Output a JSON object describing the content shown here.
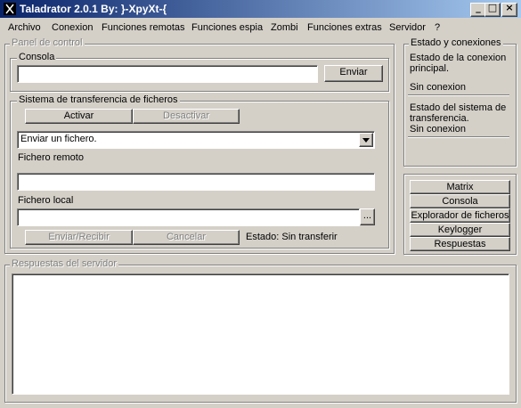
{
  "window": {
    "title": "Taladrator 2.0.1  By: }-XpyXt-{"
  },
  "menu": [
    "Archivo",
    "Conexion",
    "Funciones remotas",
    "Funciones espia",
    "Zombi",
    "Funciones extras",
    "Servidor",
    "?"
  ],
  "panel": {
    "legend": "Panel de control",
    "console": {
      "legend": "Consola",
      "input_value": "",
      "send_label": "Enviar"
    },
    "transfer": {
      "legend": "Sistema de transferencia de ficheros",
      "activate_label": "Activar",
      "deactivate_label": "Desactivar",
      "mode_selected": "Enviar un fichero.",
      "remote_label": "Fichero remoto",
      "remote_value": "",
      "local_label": "Fichero local",
      "local_value": "",
      "browse_label": "...",
      "send_receive_label": "Enviar/Recibir",
      "cancel_label": "Cancelar",
      "status_text": "Estado: Sin transferir"
    }
  },
  "status": {
    "legend": "Estado y conexiones",
    "main_label": "Estado de la conexion principal.",
    "main_value": "Sin conexion",
    "transfer_label": "Estado del sistema de transferencia.",
    "transfer_value": "Sin conexion"
  },
  "tools": [
    "Matrix",
    "Consola",
    "Explorador de ficheros",
    "Keylogger",
    "Respuestas"
  ],
  "responses": {
    "legend": "Respuestas del servidor",
    "content": ""
  }
}
